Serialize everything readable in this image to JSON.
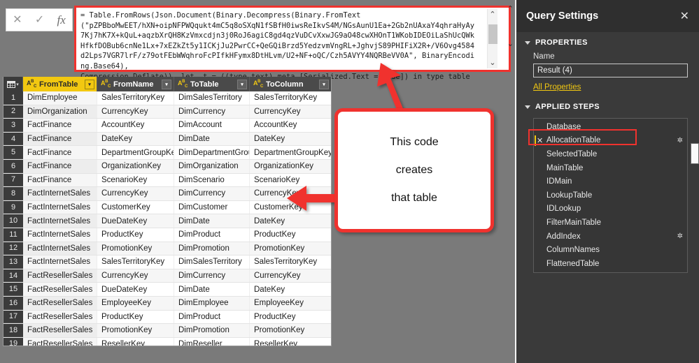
{
  "formula_bar": {
    "cancel_icon": "✕",
    "confirm_icon": "✓",
    "fx_icon": "fx",
    "formula": "= Table.FromRows(Json.Document(Binary.Decompress(Binary.FromText\n(\"pZPBboMwEET/hXN+oipNFPWQqukt4mC5q8oSXqN1fSBfH0iwsReIkvS4M/NGsAunU1Ea+2Gb2nUAxaY4qhraHyAy7Kj7hK7X+kQuL+aqzbXrQH8KzVmxcdjn3j0RoJ6agiC8gd4qzVuDCvXxwJG9aO48cwXHOnT1WKobIDEOiLaShUcQWkHfkfDOBub6cnNe1Lx+7xEZkZt5y1ICKjJu2PwrCC+QeGQiBrzd5YedzvmVngRL+JghvjS89PHIFiX2R+/V6Ovg4584d2Lps7VGR7lrF/z79otFEbWWqhroFcPIfkHFymx8DtHLvm/U2+NF+oQC/Czh5AVYY4NQRBeVV0A\", BinaryEncoding.Base64),\nCompression.Deflate)), let _t = ((type text) meta [Serialized.Text = true]) in type table",
    "scroll_up_icon": "⌃",
    "scroll_down_icon": "⌄",
    "outer_up_icon": "⌃",
    "outer_down_icon": "⌄"
  },
  "grid": {
    "corner_icon": "grid-icon",
    "corner_caret": "▾",
    "type_icon_label": "ABC",
    "filter_icon": "▾",
    "columns": [
      "FromTable",
      "FromName",
      "ToTable",
      "ToColumn"
    ],
    "selected_column": "FromTable",
    "rows": [
      {
        "n": "1",
        "FromTable": "DimEmployee",
        "FromName": "SalesTerritoryKey",
        "ToTable": "DimSalesTerritory",
        "ToColumn": "SalesTerritoryKey"
      },
      {
        "n": "2",
        "FromTable": "DimOrganization",
        "FromName": "CurrencyKey",
        "ToTable": "DimCurrency",
        "ToColumn": "CurrencyKey"
      },
      {
        "n": "3",
        "FromTable": "FactFinance",
        "FromName": "AccountKey",
        "ToTable": "DimAccount",
        "ToColumn": "AccountKey"
      },
      {
        "n": "4",
        "FromTable": "FactFinance",
        "FromName": "DateKey",
        "ToTable": "DimDate",
        "ToColumn": "DateKey"
      },
      {
        "n": "5",
        "FromTable": "FactFinance",
        "FromName": "DepartmentGroupKey",
        "ToTable": "DimDepartmentGroup",
        "ToColumn": "DepartmentGroupKey"
      },
      {
        "n": "6",
        "FromTable": "FactFinance",
        "FromName": "OrganizationKey",
        "ToTable": "DimOrganization",
        "ToColumn": "OrganizationKey"
      },
      {
        "n": "7",
        "FromTable": "FactFinance",
        "FromName": "ScenarioKey",
        "ToTable": "DimScenario",
        "ToColumn": "ScenarioKey"
      },
      {
        "n": "8",
        "FromTable": "FactInternetSales",
        "FromName": "CurrencyKey",
        "ToTable": "DimCurrency",
        "ToColumn": "CurrencyKey"
      },
      {
        "n": "9",
        "FromTable": "FactInternetSales",
        "FromName": "CustomerKey",
        "ToTable": "DimCustomer",
        "ToColumn": "CustomerKey"
      },
      {
        "n": "10",
        "FromTable": "FactInternetSales",
        "FromName": "DueDateKey",
        "ToTable": "DimDate",
        "ToColumn": "DateKey"
      },
      {
        "n": "11",
        "FromTable": "FactInternetSales",
        "FromName": "ProductKey",
        "ToTable": "DimProduct",
        "ToColumn": "ProductKey"
      },
      {
        "n": "12",
        "FromTable": "FactInternetSales",
        "FromName": "PromotionKey",
        "ToTable": "DimPromotion",
        "ToColumn": "PromotionKey"
      },
      {
        "n": "13",
        "FromTable": "FactInternetSales",
        "FromName": "SalesTerritoryKey",
        "ToTable": "DimSalesTerritory",
        "ToColumn": "SalesTerritoryKey"
      },
      {
        "n": "14",
        "FromTable": "FactResellerSales",
        "FromName": "CurrencyKey",
        "ToTable": "DimCurrency",
        "ToColumn": "CurrencyKey"
      },
      {
        "n": "15",
        "FromTable": "FactResellerSales",
        "FromName": "DueDateKey",
        "ToTable": "DimDate",
        "ToColumn": "DateKey"
      },
      {
        "n": "16",
        "FromTable": "FactResellerSales",
        "FromName": "EmployeeKey",
        "ToTable": "DimEmployee",
        "ToColumn": "EmployeeKey"
      },
      {
        "n": "17",
        "FromTable": "FactResellerSales",
        "FromName": "ProductKey",
        "ToTable": "DimProduct",
        "ToColumn": "ProductKey"
      },
      {
        "n": "18",
        "FromTable": "FactResellerSales",
        "FromName": "PromotionKey",
        "ToTable": "DimPromotion",
        "ToColumn": "PromotionKey"
      },
      {
        "n": "19",
        "FromTable": "FactResellerSales",
        "FromName": "ResellerKey",
        "ToTable": "DimReseller",
        "ToColumn": "ResellerKey"
      }
    ]
  },
  "query_settings": {
    "title": "Query Settings",
    "close_icon": "✕",
    "properties_header": "PROPERTIES",
    "name_label": "Name",
    "name_value": "Result (4)",
    "all_properties_link": "All Properties",
    "applied_steps_header": "APPLIED STEPS",
    "steps": [
      {
        "label": "Database",
        "delete_icon": "",
        "gear": false,
        "current": false
      },
      {
        "label": "AllocationTable",
        "delete_icon": "✕",
        "gear": true,
        "current": true
      },
      {
        "label": "SelectedTable",
        "delete_icon": "",
        "gear": false,
        "current": false
      },
      {
        "label": "MainTable",
        "delete_icon": "",
        "gear": false,
        "current": false
      },
      {
        "label": "IDMain",
        "delete_icon": "",
        "gear": false,
        "current": false
      },
      {
        "label": "LookupTable",
        "delete_icon": "",
        "gear": false,
        "current": false
      },
      {
        "label": "IDLookup",
        "delete_icon": "",
        "gear": false,
        "current": false
      },
      {
        "label": "FilterMainTable",
        "delete_icon": "",
        "gear": false,
        "current": false
      },
      {
        "label": "AddIndex",
        "delete_icon": "",
        "gear": true,
        "current": false
      },
      {
        "label": "ColumnNames",
        "delete_icon": "",
        "gear": false,
        "current": false
      },
      {
        "label": "FlattenedTable",
        "delete_icon": "",
        "gear": false,
        "current": false
      }
    ],
    "gear_icon": "✲"
  },
  "annotation": {
    "line1": "This code",
    "line2": "creates",
    "line3": "that table",
    "arrow_color": "#f0322e"
  },
  "colors": {
    "accent_yellow": "#f2c811",
    "annotation_red": "#f0322e",
    "panel_dark": "#3a3a3a",
    "header_dark": "#4a4a4a",
    "canvas_gray": "#7a7a7a"
  }
}
